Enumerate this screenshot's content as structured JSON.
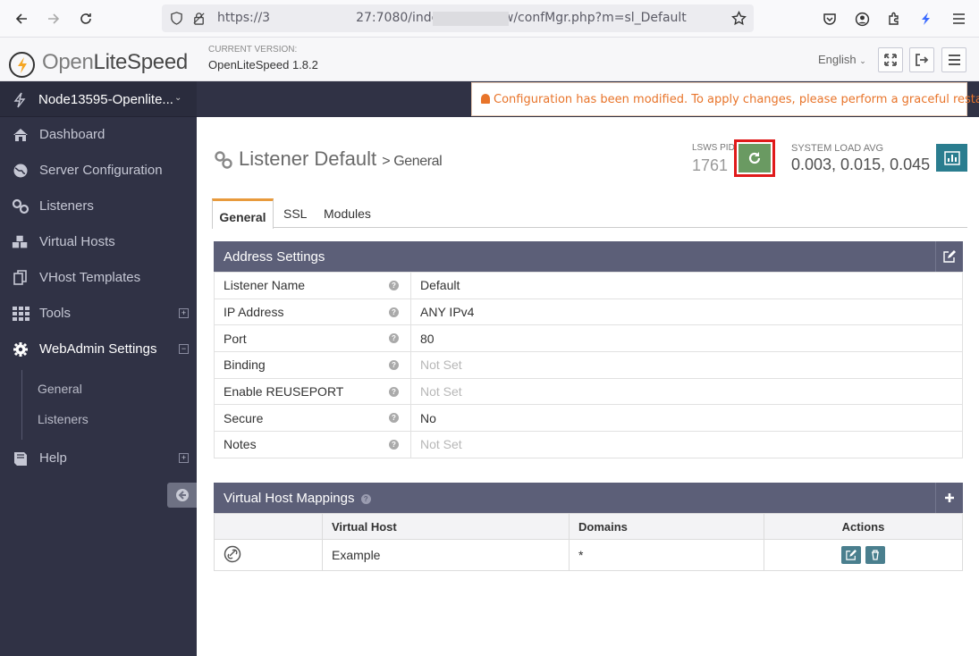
{
  "browser": {
    "url_prefix": "https://3",
    "url_suffix": "27:7080/index.php#view/confMgr.php?m=sl_Default"
  },
  "header": {
    "logo_light": "Open",
    "logo_strong": "LiteSpeed",
    "version_label": "CURRENT VERSION:",
    "version_value": "OpenLiteSpeed 1.8.2",
    "language": "English"
  },
  "sidebar": {
    "node_name": "Node13595-Openlite...",
    "items": [
      {
        "label": "Dashboard",
        "icon": "home-icon"
      },
      {
        "label": "Server Configuration",
        "icon": "globe-icon"
      },
      {
        "label": "Listeners",
        "icon": "link-icon"
      },
      {
        "label": "Virtual Hosts",
        "icon": "cubes-icon"
      },
      {
        "label": "VHost Templates",
        "icon": "copy-icon"
      },
      {
        "label": "Tools",
        "icon": "grid-icon"
      },
      {
        "label": "WebAdmin Settings",
        "icon": "gear-icon"
      },
      {
        "label": "Help",
        "icon": "book-icon"
      }
    ],
    "subitems": [
      "General",
      "Listeners"
    ]
  },
  "notice": {
    "text": "Configuration has been modified. To apply changes, please perform a graceful restart."
  },
  "page": {
    "title": "Listener Default",
    "subtitle": "> General",
    "pid_label": "LSWS PID",
    "pid_value": "1761",
    "load_label": "SYSTEM LOAD AVG",
    "load_value": "0.003, 0.015, 0.045"
  },
  "tabs": [
    "General",
    "SSL",
    "Modules"
  ],
  "address_settings": {
    "title": "Address Settings",
    "rows": [
      {
        "key": "Listener Name",
        "value": "Default"
      },
      {
        "key": "IP Address",
        "value": "ANY IPv4"
      },
      {
        "key": "Port",
        "value": "80"
      },
      {
        "key": "Binding",
        "value": "Not Set"
      },
      {
        "key": "Enable REUSEPORT",
        "value": "Not Set"
      },
      {
        "key": "Secure",
        "value": "No"
      },
      {
        "key": "Notes",
        "value": "Not Set"
      }
    ]
  },
  "vhost_mappings": {
    "title": "Virtual Host Mappings",
    "columns": [
      "Virtual Host",
      "Domains",
      "Actions"
    ],
    "rows": [
      {
        "vhost": "Example",
        "domains": "*"
      }
    ]
  },
  "colors": {
    "sidebar_bg": "#303245",
    "panel_header": "#5c5f78",
    "accent_orange": "#e89a3c",
    "restart_green": "#6a9a62",
    "highlight_red": "#e01a1a",
    "notice_text": "#e8742a"
  }
}
